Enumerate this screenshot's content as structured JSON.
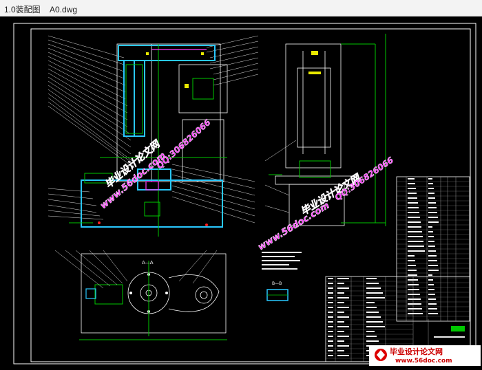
{
  "window": {
    "title": "1.0装配图    A0.dwg"
  },
  "colors": {
    "background": "#000000",
    "cyan": "#29c8ff",
    "green": "#00c800",
    "white": "#ffffff",
    "magenta": "#ff3cff",
    "red": "#ff2020"
  },
  "drawing": {
    "section_label_aa": "A—A",
    "section_label_bb": "B—B"
  },
  "watermarks": {
    "site": "www.56doc.com",
    "site_title": "毕业设计论文网",
    "qq": "QQ:306826066",
    "footer_site": "www.56doc.com",
    "footer_title": "毕业设计论文网"
  }
}
